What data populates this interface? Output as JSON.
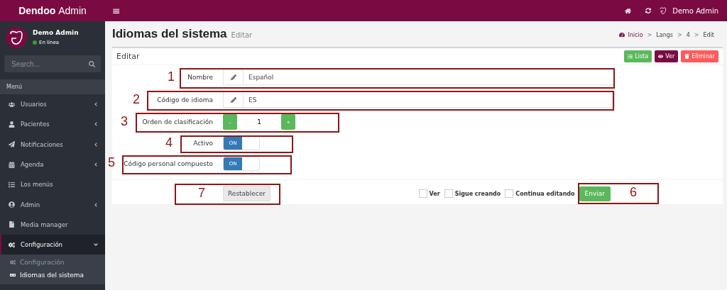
{
  "header": {
    "brand_bold": "Dendoo",
    "brand_light": "Admin",
    "menu_toggle": "≡",
    "user": "Demo Admin"
  },
  "sidebar": {
    "user": {
      "name": "Demo Admin",
      "status": "En línea"
    },
    "search": {
      "placeholder": "Search..."
    },
    "menu_header": "Menú",
    "items": [
      {
        "label": "Usuarios",
        "expandable": true,
        "expanded": false,
        "selected": false
      },
      {
        "label": "Pacientes",
        "expandable": true,
        "expanded": false,
        "selected": false
      },
      {
        "label": "Notificaciones",
        "expandable": true,
        "expanded": false,
        "selected": false
      },
      {
        "label": "Agenda",
        "expandable": true,
        "expanded": false,
        "selected": false
      },
      {
        "label": "Los menús",
        "expandable": false,
        "selected": false
      },
      {
        "label": "Admin",
        "expandable": true,
        "expanded": false,
        "selected": false
      },
      {
        "label": "Media manager",
        "expandable": false,
        "selected": false
      },
      {
        "label": "Configuración",
        "expandable": true,
        "expanded": true,
        "selected": true,
        "children": [
          {
            "label": "Configuración",
            "selected": false
          },
          {
            "label": "Idiomas del sistema",
            "selected": true
          }
        ]
      }
    ]
  },
  "page": {
    "title": "Idiomas del sistema",
    "subtitle": "Editar",
    "breadcrumb": [
      "Inicio",
      "Langs",
      "4",
      "Edit"
    ],
    "breadcrumb_separator": ">"
  },
  "card": {
    "title": "Editar",
    "actions": [
      {
        "label": "Lista",
        "kind": "list"
      },
      {
        "label": "Ver",
        "kind": "view"
      },
      {
        "label": "Eliminar",
        "kind": "delete"
      }
    ],
    "fields": [
      {
        "kind": "text",
        "label": "Nombre",
        "value": "Español"
      },
      {
        "kind": "text",
        "label": "Código de idioma",
        "value": "ES"
      },
      {
        "kind": "number",
        "label": "Orden de clasificación",
        "value": "1",
        "minus": "-",
        "plus": "+"
      },
      {
        "kind": "switch",
        "label": "Activo",
        "on": true,
        "on_text": "ON"
      },
      {
        "kind": "switch",
        "label": "Código personal compuesto",
        "on": true,
        "on_text": "ON"
      }
    ],
    "reset": "Restablecer",
    "checks": [
      {
        "label": "Ver",
        "checked": false
      },
      {
        "label": "Sigue creando",
        "checked": false
      },
      {
        "label": "Continua editando",
        "checked": false
      }
    ],
    "submit": "Enviar"
  },
  "annotations": [
    {
      "number": "1"
    },
    {
      "number": "2"
    },
    {
      "number": "3"
    },
    {
      "number": "4"
    },
    {
      "number": "5"
    },
    {
      "number": "7"
    },
    {
      "number": "6"
    }
  ]
}
